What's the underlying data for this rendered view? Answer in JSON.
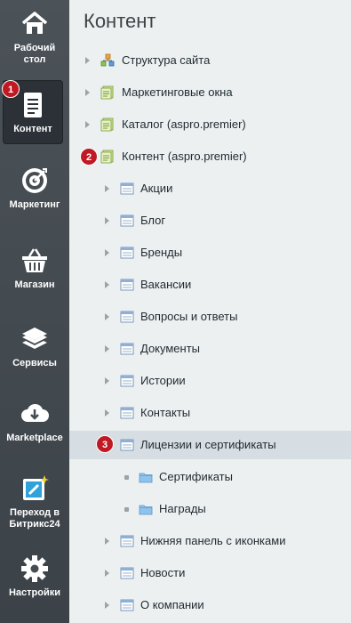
{
  "sidebar": {
    "items": [
      {
        "label_1": "Рабочий",
        "label_2": "стол",
        "icon": "home-icon"
      },
      {
        "label_1": "Контент",
        "label_2": "",
        "icon": "document-icon"
      },
      {
        "label_1": "Маркетинг",
        "label_2": "",
        "icon": "target-icon"
      },
      {
        "label_1": "Магазин",
        "label_2": "",
        "icon": "basket-icon"
      },
      {
        "label_1": "Сервисы",
        "label_2": "",
        "icon": "layers-icon"
      },
      {
        "label_1": "Marketplace",
        "label_2": "",
        "icon": "cloud-download-icon"
      },
      {
        "label_1": "Переход в",
        "label_2": "Битрикс24",
        "icon": "bitrix24-icon"
      },
      {
        "label_1": "Настройки",
        "label_2": "",
        "icon": "gear-icon"
      }
    ],
    "badge_1": "1"
  },
  "main": {
    "title": "Контент",
    "badge_2": "2",
    "badge_3": "3",
    "tree": [
      {
        "label": "Структура сайта"
      },
      {
        "label": "Маркетинговые окна"
      },
      {
        "label": "Каталог (aspro.premier)"
      },
      {
        "label": "Контент (aspro.premier)"
      },
      {
        "label": "Акции"
      },
      {
        "label": "Блог"
      },
      {
        "label": "Бренды"
      },
      {
        "label": "Вакансии"
      },
      {
        "label": "Вопросы и ответы"
      },
      {
        "label": "Документы"
      },
      {
        "label": "Истории"
      },
      {
        "label": "Контакты"
      },
      {
        "label": "Лицензии и сертификаты"
      },
      {
        "label": "Сертификаты"
      },
      {
        "label": "Награды"
      },
      {
        "label": "Нижняя панель с иконками"
      },
      {
        "label": "Новости"
      },
      {
        "label": "О компании"
      }
    ]
  }
}
